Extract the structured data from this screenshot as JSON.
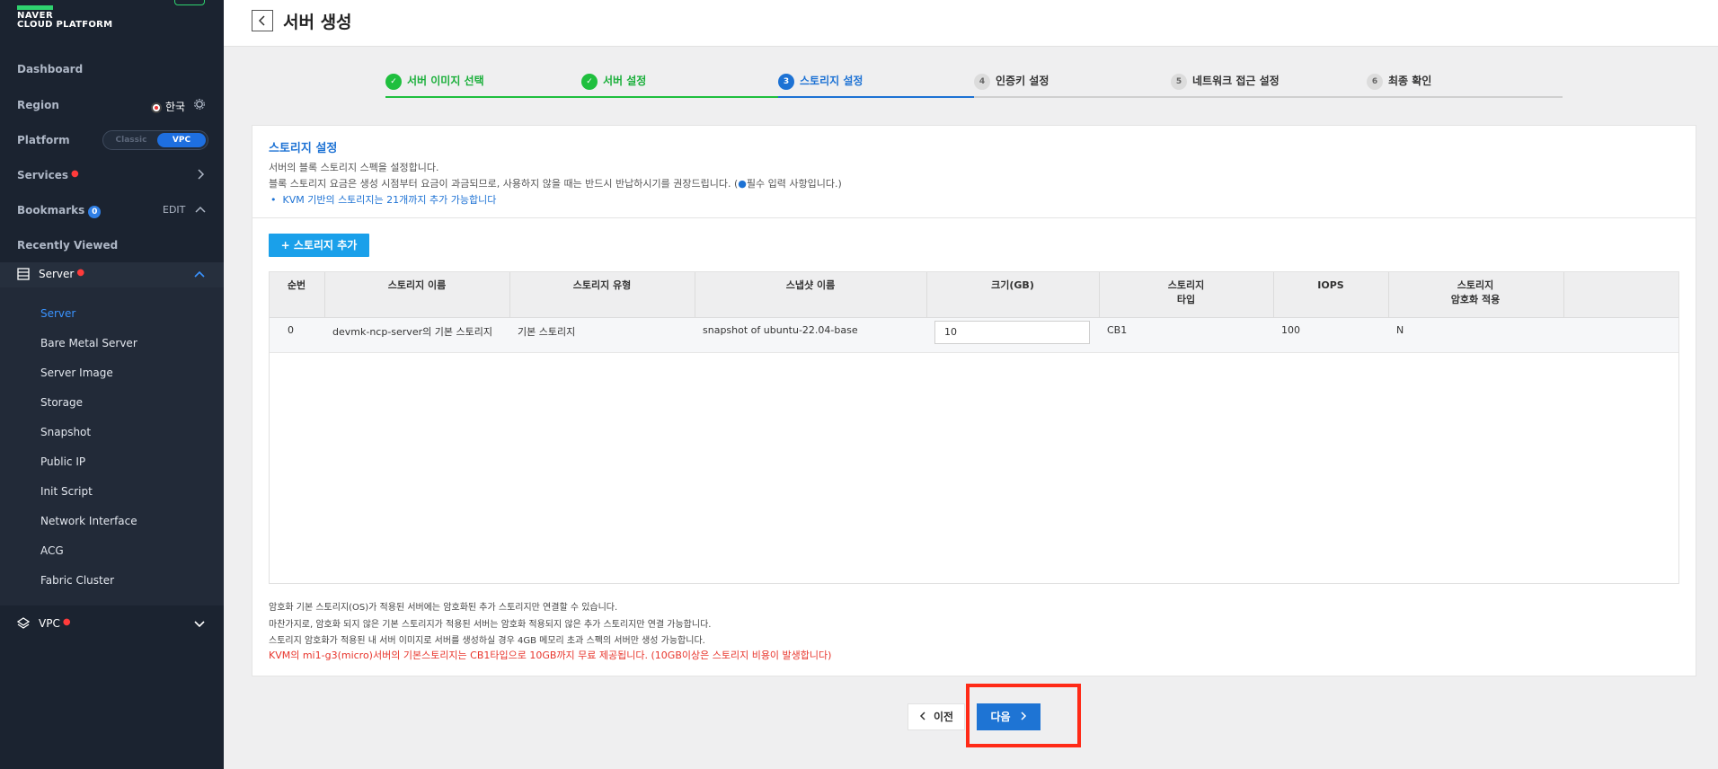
{
  "brand": {
    "line1": "NAVER",
    "line2": "CLOUD PLATFORM"
  },
  "sidebar": {
    "dashboard": "Dashboard",
    "region_label": "Region",
    "region_value": "한국",
    "platform_label": "Platform",
    "platform_options": [
      "Classic",
      "VPC"
    ],
    "platform_selected": "VPC",
    "services": "Services",
    "bookmarks": "Bookmarks",
    "bookmarks_count": "0",
    "bookmarks_edit": "EDIT",
    "recently_viewed": "Recently Viewed",
    "server_group": "Server",
    "server_items": [
      "Server",
      "Bare Metal Server",
      "Server Image",
      "Storage",
      "Snapshot",
      "Public IP",
      "Init Script",
      "Network Interface",
      "ACG",
      "Fabric Cluster"
    ],
    "active_item": "Server",
    "vpc_group": "VPC"
  },
  "header": {
    "title": "서버 생성"
  },
  "steps": [
    {
      "num": "1",
      "label": "서버 이미지 선택",
      "state": "done"
    },
    {
      "num": "2",
      "label": "서버 설정",
      "state": "done"
    },
    {
      "num": "3",
      "label": "스토리지 설정",
      "state": "current"
    },
    {
      "num": "4",
      "label": "인증키 설정",
      "state": "todo"
    },
    {
      "num": "5",
      "label": "네트워크 접근 설정",
      "state": "todo"
    },
    {
      "num": "6",
      "label": "최종 확인",
      "state": "todo"
    }
  ],
  "section": {
    "title": "스토리지 설정",
    "desc1": "서버의 블록 스토리지 스펙을 설정합니다.",
    "desc2": "블록 스토리지 요금은 생성 시점부터 요금이 과금되므로, 사용하지 않을 때는 반드시 반납하시기를 권장드립니다. (",
    "desc2_required": "●",
    "desc2_end": "필수 입력 사항입니다.)",
    "bullet": "KVM 기반의 스토리지는 21개까지 추가 가능합니다",
    "add_button": "+ 스토리지 추가"
  },
  "table": {
    "headers": [
      "순번",
      "스토리지 이름",
      "스토리지 유형",
      "스냅샷 이름",
      "크기(GB)",
      "스토리지\n타입",
      "IOPS",
      "스토리지\n암호화 적용"
    ],
    "row": {
      "index": "0",
      "name": "devmk-ncp-server의 기본 스토리지",
      "type": "기본 스토리지",
      "snapshot": "snapshot of ubuntu-22.04-base",
      "size": "10",
      "storage_type": "CB1",
      "iops": "100",
      "encryption": "N"
    }
  },
  "notes": [
    "암호화 기본 스토리지(OS)가 적용된 서버에는 암호화된 추가 스토리지만 연결할 수 있습니다.",
    "마찬가지로, 암호화 되지 않은 기본 스토리지가 적용된 서버는 암호화 적용되지 않은 추가 스토리지만 연결 가능합니다.",
    "스토리지 암호화가 적용된 내 서버 이미지로 서버를 생성하실 경우 4GB 메모리 초과 스펙의 서버만 생성 가능합니다."
  ],
  "note_red": "KVM의 mi1-g3(micro)서버의 기본스토리지는 CB1타입으로 10GB까지 무료 제공됩니다. (10GB이상은 스토리지 비용이 발생합니다)",
  "footer": {
    "prev": "이전",
    "next": "다음"
  },
  "colors": {
    "accent": "#1d72d4",
    "done": "#1fbf3e",
    "highlight": "#ff2a17",
    "sidebar_bg": "#1b2330"
  }
}
